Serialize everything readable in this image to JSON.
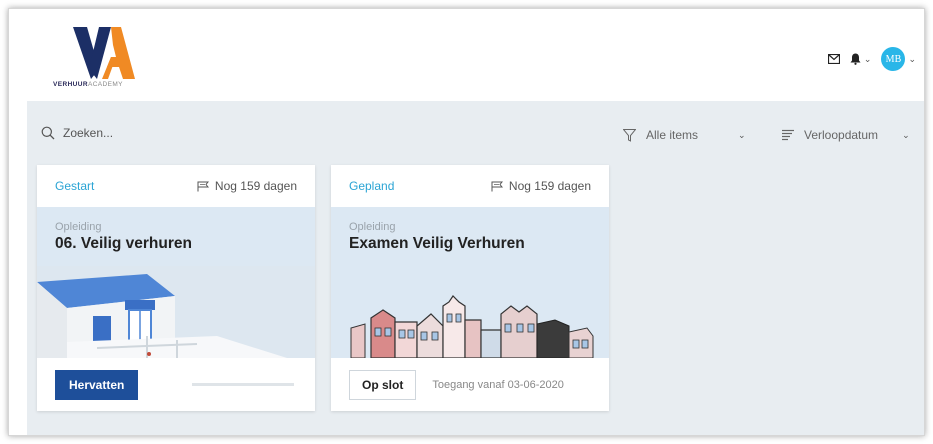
{
  "brand": {
    "logo_mark": "VA",
    "name_bold": "VERHUUR",
    "name_light": "ACADEMY",
    "color_dark": "#1c2f66",
    "color_orange": "#f08a24"
  },
  "header": {
    "avatar_initials": "MB",
    "avatar_color": "#29b6e8",
    "icons": [
      "mail-icon",
      "bell-icon",
      "chevron-down-icon"
    ]
  },
  "filters": {
    "search_placeholder": "Zoeken...",
    "items_filter": "Alle items",
    "sort_filter": "Verloopdatum"
  },
  "cards": [
    {
      "status": "Gestart",
      "days_left": "Nog 159 dagen",
      "kind": "Opleiding",
      "title": "06. Veilig verhuren",
      "action_label": "Hervatten",
      "progress": 0.0
    },
    {
      "status": "Gepland",
      "days_left": "Nog 159 dagen",
      "kind": "Opleiding",
      "title": "Examen Veilig Verhuren",
      "action_label": "Op slot",
      "access_text": "Toegang vanaf 03-06-2020"
    }
  ],
  "colors": {
    "accent_blue": "#1e4f9a",
    "status_blue": "#2aa4d4",
    "background": "#e8edf1",
    "banner": "#dce8f3"
  }
}
